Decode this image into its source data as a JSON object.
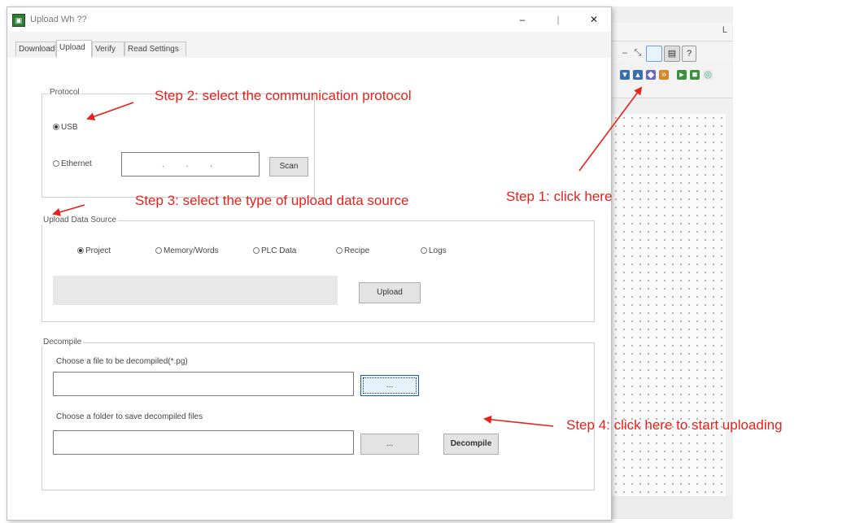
{
  "background_editor": {
    "menu_fragment": "L"
  },
  "dialog": {
    "title": "Upload Wh ??",
    "tabs": [
      {
        "label": "Download"
      },
      {
        "label": "Upload"
      },
      {
        "label": "Verify"
      },
      {
        "label": "Read Settings"
      }
    ],
    "active_tab": "Upload",
    "protocol_group": {
      "title": "Protocol",
      "usb_label": "USB",
      "ethernet_label": "Ethernet",
      "ip_value": ". . .",
      "scan_button": "Scan"
    },
    "source_group": {
      "title": "Upload Data Source",
      "options": [
        {
          "label": "Project",
          "checked": true
        },
        {
          "label": "Memory/Words",
          "checked": false
        },
        {
          "label": "PLC Data",
          "checked": false
        },
        {
          "label": "Recipe",
          "checked": false
        },
        {
          "label": "Logs",
          "checked": false
        }
      ],
      "upload_button": "Upload"
    },
    "decompile_group": {
      "title": "Decompile",
      "file_label": "Choose a file to be decompiled(*.pg)",
      "folder_label": "Choose a folder to save decompiled files",
      "browse_label": "...",
      "decompile_button": "Decompile"
    }
  },
  "annotations": {
    "step1": "Step 1: click here",
    "step2": "Step 2: select the communication protocol",
    "step3": "Step 3: select the type of upload data source",
    "step4": "Step 4: click here to start uploading"
  },
  "colors": {
    "annotation": "#e8211c",
    "app_icon": "#2e7d32"
  }
}
